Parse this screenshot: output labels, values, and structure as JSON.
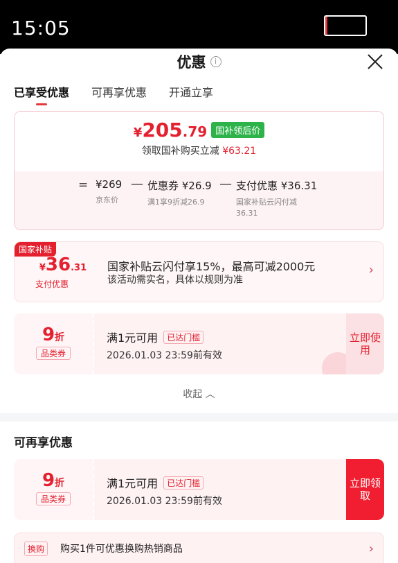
{
  "status_bar": {
    "time": "15:05"
  },
  "header": {
    "title": "优惠",
    "info_glyph": "i"
  },
  "tabs": [
    {
      "label": "已享受优惠",
      "active": true
    },
    {
      "label": "可再享优惠",
      "active": false
    },
    {
      "label": "开通立享",
      "active": false
    }
  ],
  "summary": {
    "currency": "¥",
    "price_int": "205",
    "price_dec": ".79",
    "tag": "国补领后价",
    "subsidy_text": "领取国补购买立减",
    "subsidy_amount": "¥63.21",
    "equals": "=",
    "minus": "—",
    "base": {
      "value": "¥269",
      "label": "京东价"
    },
    "coupon": {
      "value": "优惠券 ¥26.9",
      "label": "满1享9折减26.9"
    },
    "payment": {
      "value": "支付优惠 ¥36.31",
      "label_line1": "国家补贴云闪付减",
      "label_line2": "36.31"
    }
  },
  "gov_subsidy": {
    "badge": "国家补贴",
    "currency": "¥",
    "amount_int": "36",
    "amount_dec": ".31",
    "label": "支付优惠",
    "line1": "国家补贴云闪付享15%，最高可减2000元",
    "line2": "该活动需实名，具体以规则为准",
    "chevron": "›"
  },
  "coupons_used": [
    {
      "discount": "9",
      "unit": "折",
      "type": "品类券",
      "title": "满1元可用",
      "reached": "已达门槛",
      "expire": "2026.01.03 23:59前有效",
      "action": "立即使用"
    }
  ],
  "collapse_label": "收起 ︿",
  "section_more": "可再享优惠",
  "coupons_available": [
    {
      "discount": "9",
      "unit": "折",
      "type": "品类券",
      "title": "满1元可用",
      "reached": "已达门槛",
      "expire": "2026.01.03 23:59前有效",
      "action": "立即领取"
    }
  ],
  "exchange": {
    "tag": "换购",
    "text": "购买1件可优惠换购热销商品",
    "chevron": "›"
  },
  "colors": {
    "accent": "#e4202f",
    "green_tag": "#2db34a",
    "claim": "#f01e30"
  }
}
